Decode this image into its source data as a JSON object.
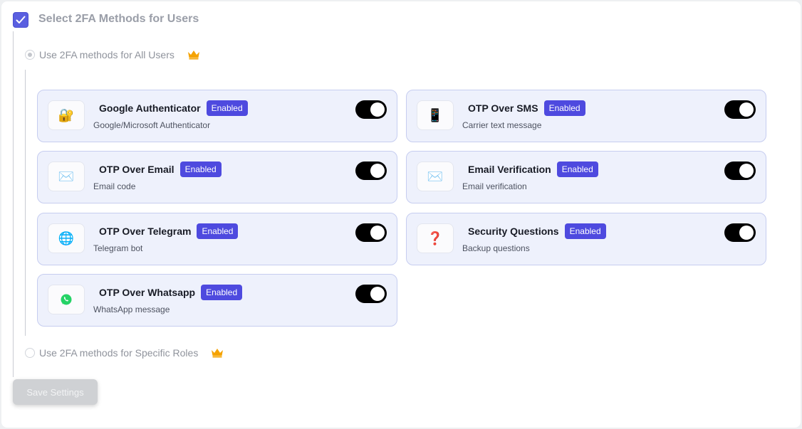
{
  "section": {
    "title": "Select 2FA Methods for Users",
    "checked": true
  },
  "options": {
    "all_users": {
      "label": "Use 2FA methods for All Users",
      "selected": true,
      "premium_icon": "crown-icon"
    },
    "specific_roles": {
      "label": "Use 2FA methods for Specific Roles",
      "selected": false,
      "premium_icon": "crown-icon"
    }
  },
  "badge_text": "Enabled",
  "methods": [
    {
      "name": "google-authenticator",
      "title": "Google Authenticator",
      "subtitle": "Google/Microsoft Authenticator",
      "icon": "lock-key-icon",
      "glyph": "🔐",
      "enabled": true
    },
    {
      "name": "otp-over-sms",
      "title": "OTP Over SMS",
      "subtitle": "Carrier text message",
      "icon": "mobile-phone-icon",
      "glyph": "📱",
      "enabled": true
    },
    {
      "name": "otp-over-email",
      "title": "OTP Over Email",
      "subtitle": "Email code",
      "icon": "envelope-icon",
      "glyph": "✉️",
      "enabled": true
    },
    {
      "name": "email-verification",
      "title": "Email Verification",
      "subtitle": "Email verification",
      "icon": "envelope-icon",
      "glyph": "✉️",
      "enabled": true
    },
    {
      "name": "otp-over-telegram",
      "title": "OTP Over Telegram",
      "subtitle": "Telegram bot",
      "icon": "globe-icon",
      "glyph": "🌐",
      "enabled": true
    },
    {
      "name": "security-questions",
      "title": "Security Questions",
      "subtitle": "Backup questions",
      "icon": "question-mark-icon",
      "glyph": "❓",
      "enabled": true
    },
    {
      "name": "otp-over-whatsapp",
      "title": "OTP Over Whatsapp",
      "subtitle": "WhatsApp message",
      "icon": "whatsapp-icon",
      "glyph": "",
      "enabled": true
    }
  ],
  "save_button": {
    "label": "Save Settings"
  },
  "colors": {
    "accent": "#5a5fe0",
    "badge": "#4e4adf",
    "card_bg": "#eef1fc",
    "card_border": "#c6cdf0",
    "crown": "#f5a300",
    "toggle_on": "#000000"
  }
}
